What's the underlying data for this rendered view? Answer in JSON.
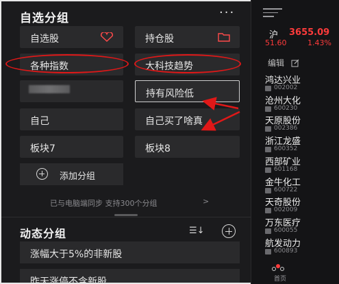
{
  "header": {
    "title": "自选分组",
    "more_label": "···"
  },
  "groups": {
    "r1c1": "自选股",
    "r1c2": "持仓股",
    "r2c1": "各种指数",
    "r2c2": "大科技趋势",
    "r3c2": "持有风险低",
    "r4c1": "自己",
    "r4c2": "自己买了啥真",
    "r5c1": "板块7",
    "r5c2": "板块8"
  },
  "add_group_label": "添加分组",
  "sync_text": "已与电脑端同步 支持300个分组",
  "sync_chevron": ">",
  "dynamic": {
    "title": "动态分组",
    "sort_label": "☰↓",
    "rows": [
      "涨幅大于5%的非新股",
      "昨天涨停不含新股"
    ]
  },
  "index": {
    "name": "沪",
    "value": "3655.09",
    "change": "51.60",
    "percent": "1.43%"
  },
  "edit_label": "编辑",
  "stocks": [
    {
      "name": "鸿达兴业",
      "code": "002002"
    },
    {
      "name": "沧州大化",
      "code": "600230"
    },
    {
      "name": "天原股份",
      "code": "002386"
    },
    {
      "name": "浙江龙盛",
      "code": "600352"
    },
    {
      "name": "西部矿业",
      "code": "601168"
    },
    {
      "name": "金牛化工",
      "code": "600722"
    },
    {
      "name": "天奇股份",
      "code": "002009"
    },
    {
      "name": "万东医疗",
      "code": "600055"
    },
    {
      "name": "航发动力",
      "code": "600893"
    }
  ],
  "nav": {
    "home_label": "首页"
  },
  "colors": {
    "accent_red": "#ff3b3b",
    "annotation_red": "#e01818",
    "bg": "#1b1b1d",
    "tile": "#2a2a2c"
  }
}
